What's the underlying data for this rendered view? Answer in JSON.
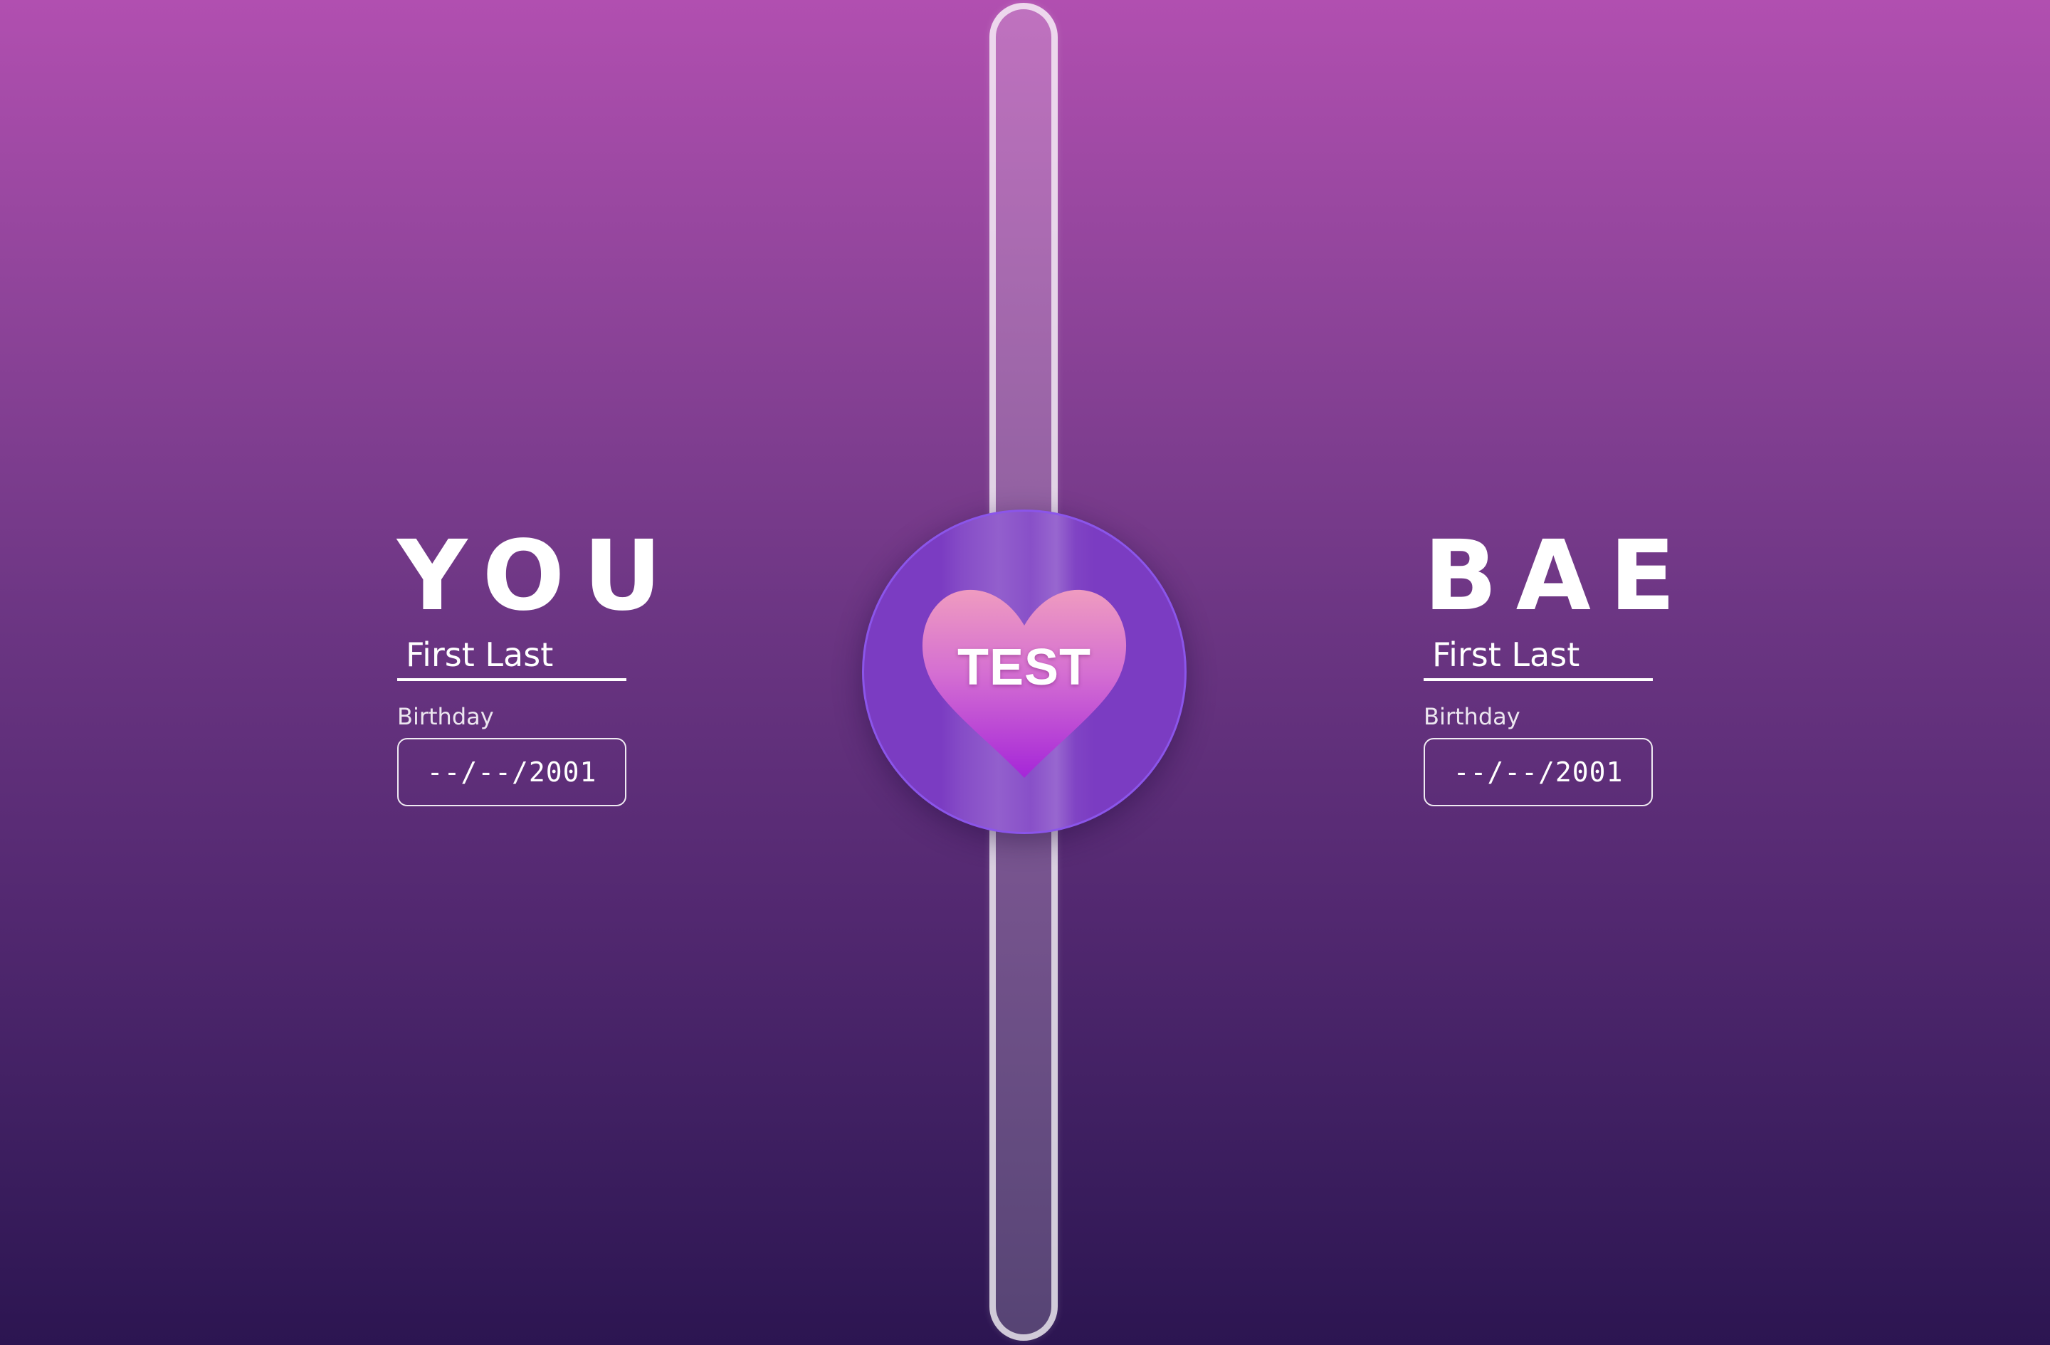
{
  "colors": {
    "background_top": "#b14fb0",
    "background_bottom": "#2c1551",
    "circle": "#7b3cc2",
    "heart_top": "#ef9bc0",
    "heart_bottom": "#a526d8",
    "text": "#ffffff"
  },
  "center": {
    "button_label": "TEST",
    "icon": "heart-icon"
  },
  "left_person": {
    "title": "YOU",
    "name_value": "First Last",
    "birthday_label": "Birthday",
    "birthday_value": "--/--/2001"
  },
  "right_person": {
    "title": "BAE",
    "name_value": "First Last",
    "birthday_label": "Birthday",
    "birthday_value": "--/--/2001"
  }
}
